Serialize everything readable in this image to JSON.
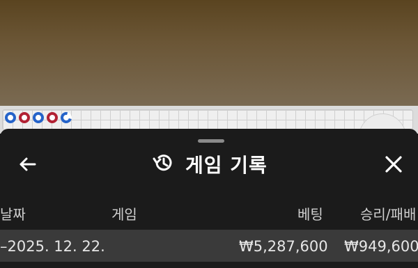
{
  "colors": {
    "banker_red": "#b22234",
    "player_blue": "#2563c9",
    "sheet_bg": "#1b1b1b",
    "row_highlight": "#3a3a3a"
  },
  "road": {
    "markers": [
      "player-blue",
      "banker-red",
      "player-blue",
      "banker-red",
      "player-blue"
    ]
  },
  "sheet": {
    "title": "게임 기록",
    "back_icon": "arrow-left-icon",
    "history_icon": "history-icon",
    "close_icon": "close-icon"
  },
  "table": {
    "headers": {
      "date": "날짜",
      "game": "게임",
      "bet": "베팅",
      "win_loss": "승리/패배"
    },
    "rows": [
      {
        "date": "–2025. 12. 22.",
        "game": "",
        "bet": "₩5,287,600",
        "win_loss": "₩949,600"
      }
    ]
  }
}
